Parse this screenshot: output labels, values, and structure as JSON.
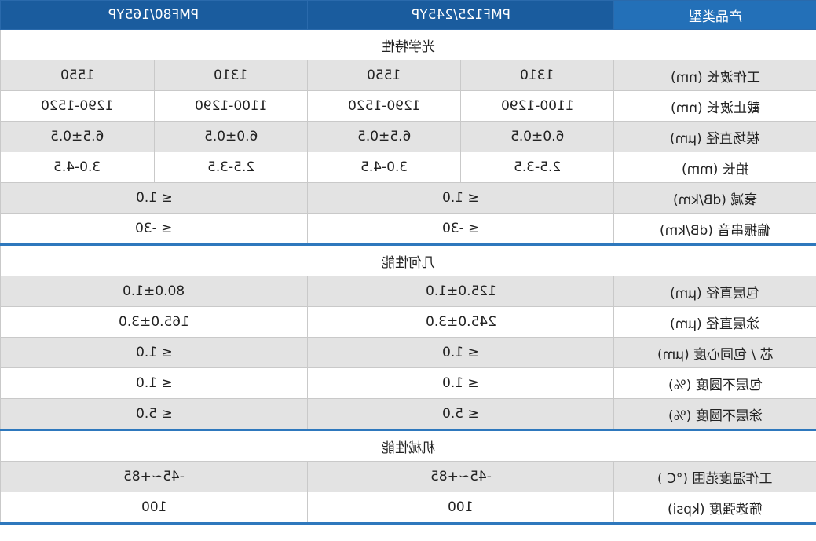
{
  "header": {
    "col_product_type": "产品类型",
    "col_pmf125": "PMF125/245YP",
    "col_pmf80": "PMF80/165YP"
  },
  "sections": {
    "optical": "光学特性",
    "geometric": "几何性能",
    "mechanical": "机械性能"
  },
  "optical_rows": {
    "operating_wavelength": {
      "label": "工作波长 (nm)",
      "values": [
        "1310",
        "1550",
        "1310",
        "1550"
      ]
    },
    "cutoff_wavelength": {
      "label": "截止波长 (nm)",
      "values": [
        "1100-1290",
        "1290-1520",
        "1100-1290",
        "1290-1520"
      ]
    },
    "mode_field_diameter": {
      "label": "模场直径 (μm)",
      "values": [
        "6.0±0.5",
        "6.5±0.5",
        "6.0±0.5",
        "6.5±0.5"
      ]
    },
    "beat_length": {
      "label": "拍长 (mm)",
      "values": [
        "2.5-3.5",
        "3.0-4.5",
        "2.5-3.5",
        "3.0-4.5"
      ]
    },
    "attenuation": {
      "label": "衰减 (dB/km)",
      "values": [
        "≤ 1.0",
        "≤ 1.0"
      ]
    },
    "polarization_crosstalk": {
      "label": "偏振串音 (dB/km)",
      "values": [
        "≤ -30",
        "≤ -30"
      ]
    }
  },
  "geometric_rows": {
    "cladding_diameter": {
      "label": "包层直径 (μm)",
      "values": [
        "125.0±1.0",
        "80.0±1.0"
      ]
    },
    "coating_diameter": {
      "label": "涂层直径 (μm)",
      "values": [
        "245.0±3.0",
        "165.0±3.0"
      ]
    },
    "core_cladding_concentricity": {
      "label": "芯 / 包同心度 (μm)",
      "values": [
        "≤ 1.0",
        "≤ 1.0"
      ]
    },
    "cladding_noncircularity": {
      "label": "包层不圆度 (%)",
      "values": [
        "≤ 1.0",
        "≤ 1.0"
      ]
    },
    "coating_noncircularity": {
      "label": "涂层不圆度 (%)",
      "values": [
        "≤ 5.0",
        "≤ 5.0"
      ]
    }
  },
  "mechanical_rows": {
    "operating_temperature": {
      "label": "工作温度范围 (°C )",
      "values": [
        "-45~+85",
        "-45~+85"
      ]
    },
    "proof_test": {
      "label": "筛选强度 (kpsi)",
      "values": [
        "100",
        "100"
      ]
    }
  },
  "colors": {
    "header_bg": "#1a5c9e",
    "band_bg": "#e3e3e3",
    "section_rule": "#2e78bd"
  }
}
